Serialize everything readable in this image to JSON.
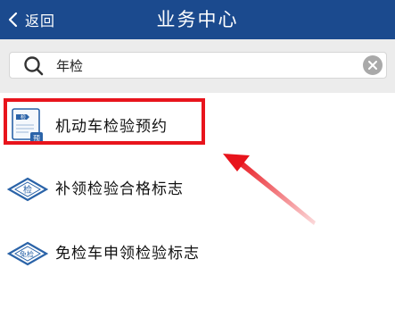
{
  "header": {
    "back_label": "返回",
    "title": "业务中心",
    "background_color": "#1b4a8e"
  },
  "search": {
    "value": "年检",
    "icon": "search-icon",
    "clear_icon": "clear-icon"
  },
  "items": [
    {
      "label": "机动车检验预约",
      "icon": "inspection-appointment-icon",
      "icon_text": "检",
      "icon_badge": "预",
      "highlighted": true
    },
    {
      "label": "补领检验合格标志",
      "icon": "inspection-sign-diamond-icon",
      "icon_text": "检"
    },
    {
      "label": "免检车申领检验标志",
      "icon": "exempt-inspection-diamond-icon",
      "icon_text": "免检"
    }
  ],
  "annotation": {
    "highlight_color": "#e8141c",
    "arrow_color": "#e8141c"
  }
}
